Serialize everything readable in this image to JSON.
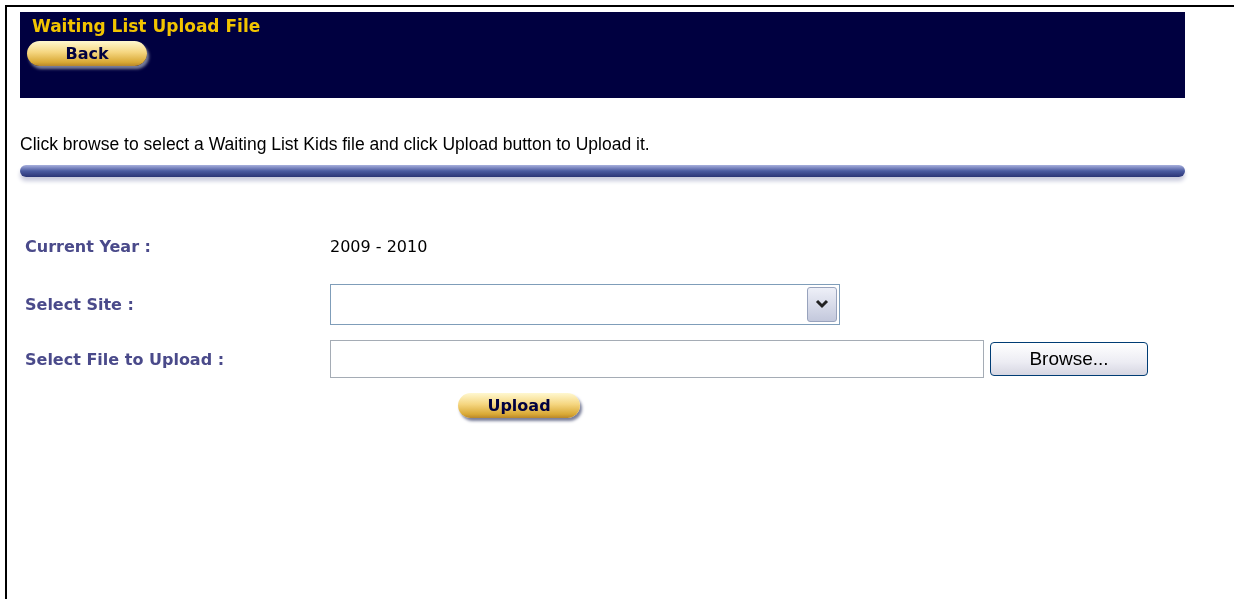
{
  "header": {
    "title": "Waiting List Upload File",
    "back_button": "Back"
  },
  "instruction": "Click browse to select a Waiting List Kids file and click Upload button to Upload it.",
  "fields": [
    {
      "kind": "text",
      "label": "Current Year :",
      "value": "2009 - 2010"
    },
    {
      "kind": "select",
      "label": "Select Site :"
    },
    {
      "kind": "file",
      "label": "Select File to Upload :",
      "button": "Browse..."
    }
  ],
  "upload_button": "Upload"
}
